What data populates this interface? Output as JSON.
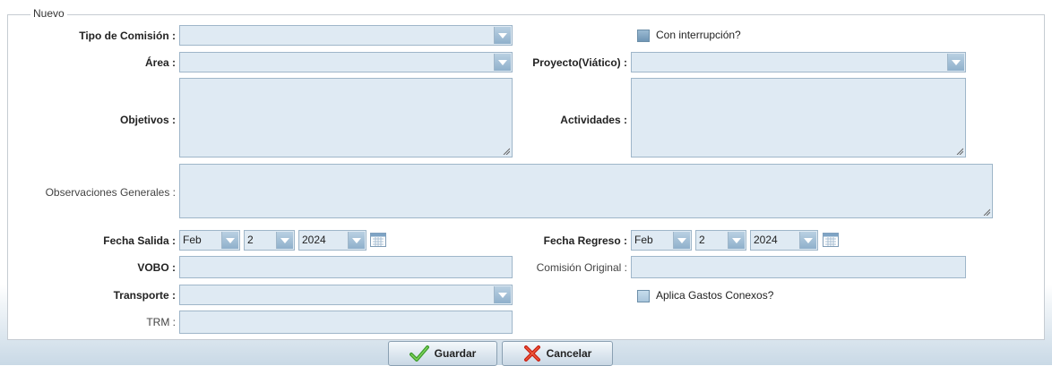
{
  "form": {
    "legend": "Nuevo",
    "labels": {
      "tipo_comision": "Tipo de Comisión :",
      "area": "Área :",
      "proyecto": "Proyecto(Viático) :",
      "objetivos": "Objetivos :",
      "actividades": "Actividades :",
      "observaciones": "Observaciones Generales :",
      "fecha_salida": "Fecha Salida :",
      "fecha_regreso": "Fecha Regreso :",
      "vobo": "VOBO :",
      "comision_original": "Comisión Original :",
      "transporte": "Transporte :",
      "trm": "TRM :"
    },
    "checkboxes": {
      "con_interrupcion": "Con interrupción?",
      "aplica_gastos": "Aplica Gastos Conexos?"
    },
    "fecha_salida": {
      "month": "Feb",
      "day": "2",
      "year": "2024"
    },
    "fecha_regreso": {
      "month": "Feb",
      "day": "2",
      "year": "2024"
    }
  },
  "buttons": {
    "guardar": "Guardar",
    "cancelar": "Cancelar"
  },
  "icons": {
    "dropdown": "chevron-down-icon",
    "calendar": "calendar-icon",
    "save": "checkmark-icon",
    "cancel": "x-icon"
  }
}
